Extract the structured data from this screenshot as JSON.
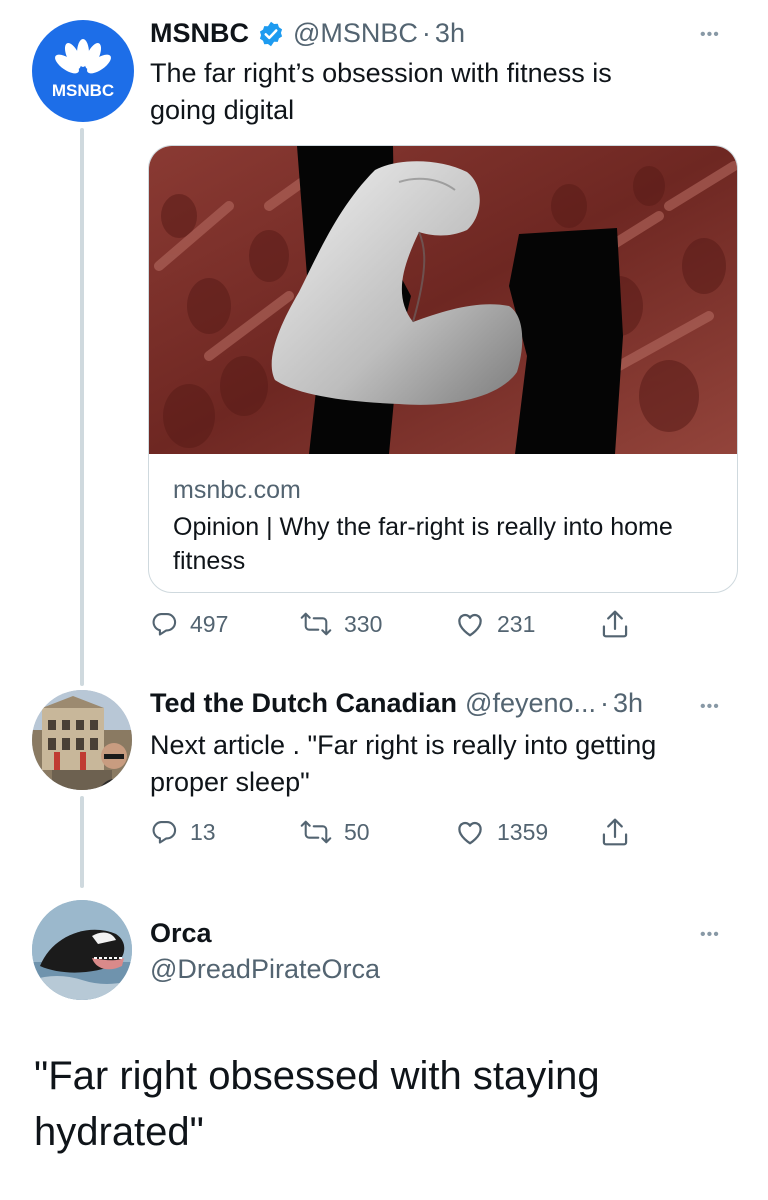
{
  "tweet1": {
    "avatar_text": "MSNBC",
    "name": "MSNBC",
    "handle": "@MSNBC",
    "separator": "·",
    "time": "3h",
    "text_line1": "The far right’s obsession with fitness is",
    "text_line2": "going digital",
    "card": {
      "domain": "msnbc.com",
      "title": "Opinion | Why the far-right is really into home fitness"
    },
    "actions": {
      "replies": "497",
      "retweets": "330",
      "likes": "231"
    },
    "more": "•••"
  },
  "tweet2": {
    "name": "Ted the Dutch Canadian",
    "handle": "@feyeno...",
    "separator": "·",
    "time": "3h",
    "text_line1": "Next article . \"Far right is really into getting",
    "text_line2": "proper sleep\"",
    "actions": {
      "replies": "13",
      "retweets": "50",
      "likes": "1359"
    },
    "more": "•••"
  },
  "tweet3": {
    "name": "Orca",
    "handle": "@DreadPirateOrca",
    "text_line1": "\"Far right obsessed with staying",
    "text_line2": "hydrated\"",
    "more": "•••"
  },
  "colors": {
    "msnbc_blue": "#1d6ee8",
    "verified_blue": "#1d9bf0",
    "muted_text": "#536471",
    "thread_line": "#cfd9de",
    "card_image_red": "#7a2a24"
  },
  "icons": [
    "verified-badge-icon",
    "reply-icon",
    "retweet-icon",
    "like-icon",
    "share-icon",
    "more-icon",
    "peacock-logo-icon"
  ]
}
